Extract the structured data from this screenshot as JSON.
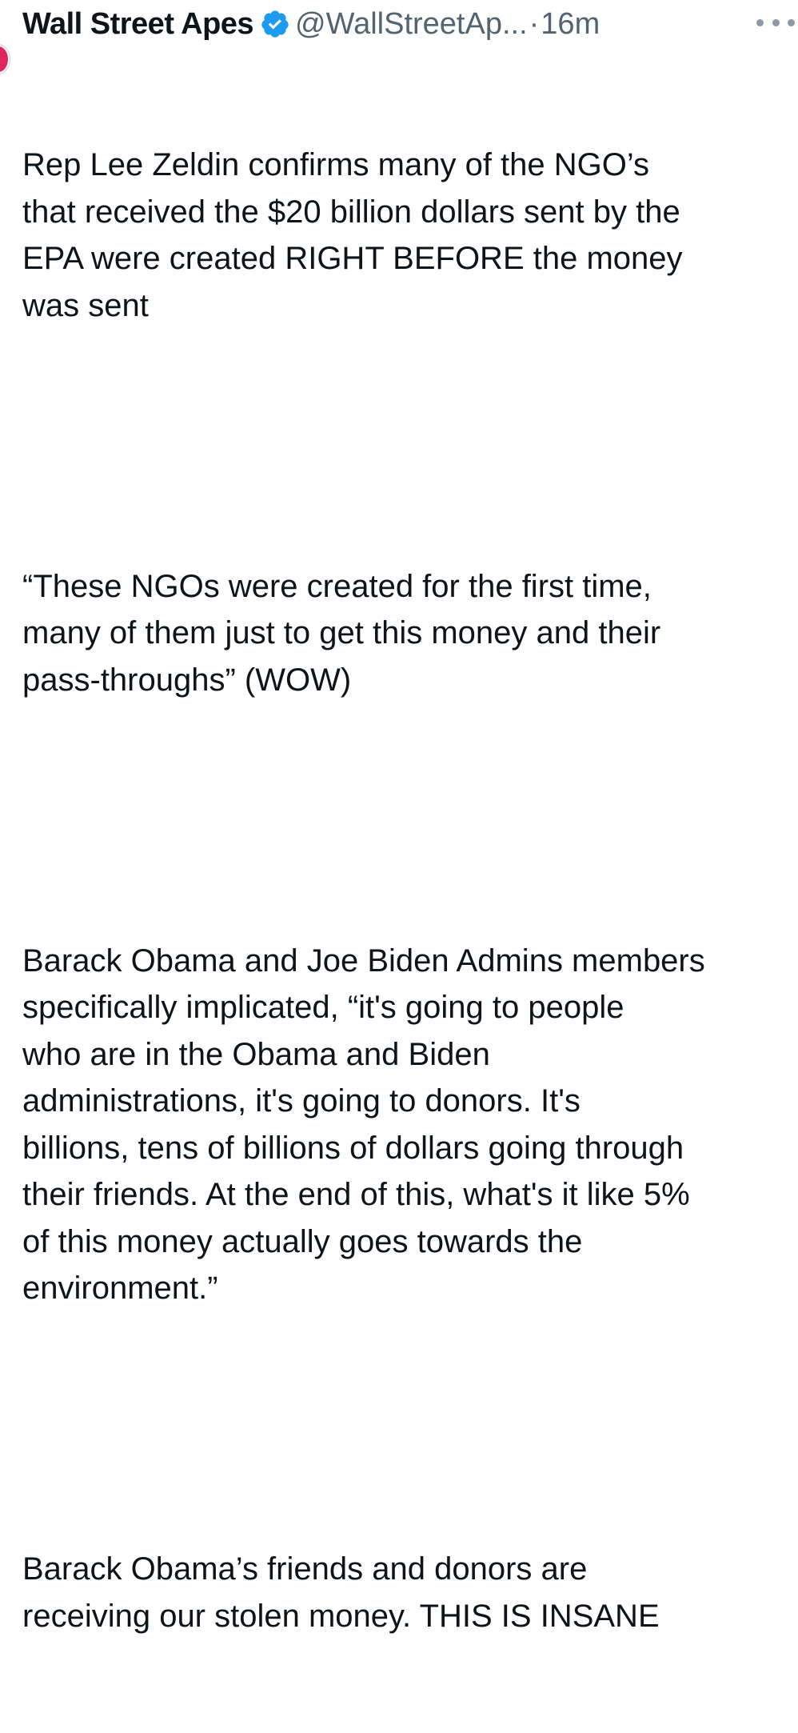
{
  "tweet": {
    "author": {
      "display_name": "Wall Street Apes",
      "handle": "@WallStreetAp...",
      "verified": true,
      "verified_icon": "verified-badge-icon",
      "verified_color": "#1d9bf0"
    },
    "separator": "·",
    "timestamp": "16m",
    "more_icon": "more-horizontal-icon",
    "paragraphs": [
      "Rep Lee Zeldin confirms many of the NGO’s\nthat received the $20 billion dollars sent by the\nEPA were created RIGHT BEFORE the money\nwas sent",
      "“These NGOs were created for the first time,\nmany of them just to get this money and their\npass-throughs” (WOW)",
      "Barack Obama and Joe Biden Admins members\nspecifically implicated, “it's going to people\nwho are in the Obama and Biden\nadministrations, it's going to donors. It's\nbillions, tens of billions of dollars going through\ntheir friends. At the end of this, what's it like 5%\nof this money actually goes towards the\nenvironment.”",
      "Barack Obama’s friends and donors are\nreceiving our stolen money. THIS IS INSANE"
    ]
  },
  "colors": {
    "text": "#0f1419",
    "secondary": "#536471",
    "accent": "#1d9bf0"
  }
}
